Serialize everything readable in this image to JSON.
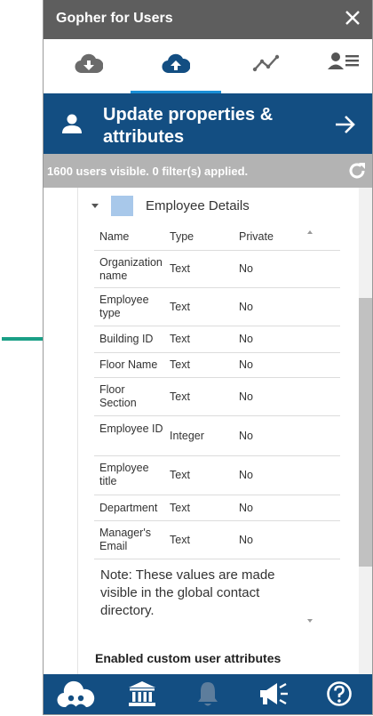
{
  "app": {
    "title": "Gopher for Users"
  },
  "action": {
    "line1": "Update properties &",
    "line2": "attributes"
  },
  "status": {
    "text": "1600 users visible.  0 filter(s) applied."
  },
  "group": {
    "title": "Employee Details",
    "color": "#a8c8ea"
  },
  "table": {
    "headers": {
      "name": "Name",
      "type": "Type",
      "private": "Private"
    },
    "rows": [
      {
        "name": "Organization name",
        "type": "Text",
        "private": "No"
      },
      {
        "name": "Employee type",
        "type": "Text",
        "private": "No"
      },
      {
        "name": "Building ID",
        "type": "Text",
        "private": "No"
      },
      {
        "name": "Floor Name",
        "type": "Text",
        "private": "No"
      },
      {
        "name": "Floor Section",
        "type": "Text",
        "private": "No"
      },
      {
        "name": "Employee ID",
        "type": "Integer",
        "private": "No"
      },
      {
        "name": "Employee title",
        "type": "Text",
        "private": "No"
      },
      {
        "name": "Department",
        "type": "Text",
        "private": "No"
      },
      {
        "name": "Manager's Email",
        "type": "Text",
        "private": "No"
      }
    ]
  },
  "note": "Note: These values are made visible in the global contact directory.",
  "custom_section": "Enabled custom user attributes",
  "colors": {
    "titlebar": "#5e5e5e",
    "primary": "#134e82",
    "tab_active": "#1a8fd6",
    "statusbar": "#b3b3b3",
    "pointer_arrow": "#1a9f86"
  },
  "icons": {
    "tabs": [
      "cloud-download-icon",
      "cloud-upload-icon",
      "trend-line-icon",
      "user-list-icon"
    ],
    "bottom_nav": [
      "cloud-users-icon",
      "bank-icon",
      "bell-icon",
      "megaphone-icon",
      "help-icon"
    ]
  }
}
